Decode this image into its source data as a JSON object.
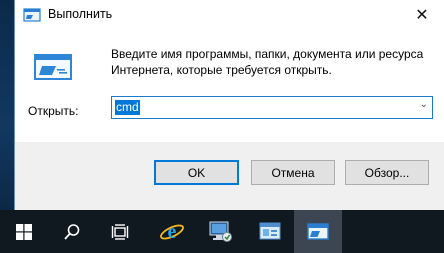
{
  "dialog": {
    "title": "Выполнить",
    "description": "Введите имя программы, папки, документа или ресурса Интернета, которые требуется открыть.",
    "open_label": "Открыть:",
    "open_value": "cmd",
    "close_glyph": "✕",
    "dropdown_glyph": "⌄",
    "buttons": {
      "ok": "OK",
      "cancel": "Отмена",
      "browse": "Обзор..."
    }
  },
  "taskbar": {
    "items": [
      {
        "name": "start",
        "icon": "windows-logo-icon"
      },
      {
        "name": "search",
        "icon": "search-icon"
      },
      {
        "name": "task-view",
        "icon": "task-view-icon"
      },
      {
        "name": "internet-explorer",
        "icon": "internet-explorer-icon"
      },
      {
        "name": "server-manager",
        "icon": "server-manager-icon"
      },
      {
        "name": "control-panel",
        "icon": "control-panel-icon"
      },
      {
        "name": "run",
        "icon": "run-icon",
        "active": true
      }
    ]
  },
  "colors": {
    "accent": "#0078d7",
    "taskbar": "#101820",
    "footer": "#f0f0f0"
  }
}
